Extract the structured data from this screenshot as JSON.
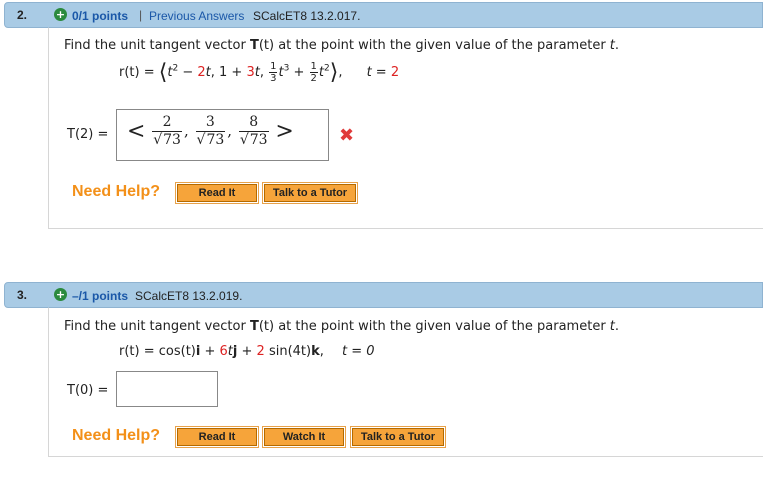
{
  "q2": {
    "number": "2.",
    "points": "0/1 points",
    "separator": "|",
    "previous_answers": "Previous Answers",
    "source": "SCalcET8 13.2.017.",
    "prompt_pre": "Find the unit tangent vector ",
    "prompt_T": "T",
    "prompt_mid": "(t) at the point with the given value of the parameter ",
    "prompt_t": "t",
    "prompt_end": ".",
    "equation": {
      "lhs": "r(t) = ",
      "c1a": "t",
      "c1b": "2",
      "c1c": " − ",
      "c1d": "2",
      "c1e": "t",
      "c2a": "1 + ",
      "c2b": "3",
      "c2c": "t",
      "c3_frac_num": "1",
      "c3_frac_den": "3",
      "c3a": "t",
      "c3b": "3",
      "c3plus": " + ",
      "c3_frac2_num": "1",
      "c3_frac2_den": "2",
      "c3c": "t",
      "c3d": "2",
      "param": "t = ",
      "param_val": "2"
    },
    "answer_label": "T(2) =",
    "answer": {
      "n1": "2",
      "d1": "73",
      "n2": "3",
      "d2": "73",
      "n3": "8",
      "d3": "73"
    },
    "incorrect_mark": "✖",
    "need_help": "Need Help?",
    "buttons": [
      "Read It",
      "Talk to a Tutor"
    ]
  },
  "q3": {
    "number": "3.",
    "points": "–/1 points",
    "source": "SCalcET8 13.2.019.",
    "prompt_pre": "Find the unit tangent vector ",
    "prompt_T": "T",
    "prompt_mid": "(t) at the point with the given value of the parameter ",
    "prompt_t": "t",
    "prompt_end": ".",
    "equation": {
      "lhs": "r(t) = cos(t)",
      "i": "i",
      "plus1": " + ",
      "six": "6",
      "t1": "t",
      "j": "j",
      "plus2": " + ",
      "two": "2",
      "sin": " sin(4t)",
      "k": "k",
      "comma": ",",
      "param": "t = 0"
    },
    "answer_label": "T(0) =",
    "answer_value": "",
    "need_help": "Need Help?",
    "buttons": [
      "Read It",
      "Watch It",
      "Talk to a Tutor"
    ]
  },
  "colors": {
    "header_bar": "#a9cbe5",
    "link": "#1a57a8",
    "need_help": "#f39019",
    "button": "#f6a43a",
    "incorrect": "#e03a3a",
    "red_text": "#dd2222"
  }
}
